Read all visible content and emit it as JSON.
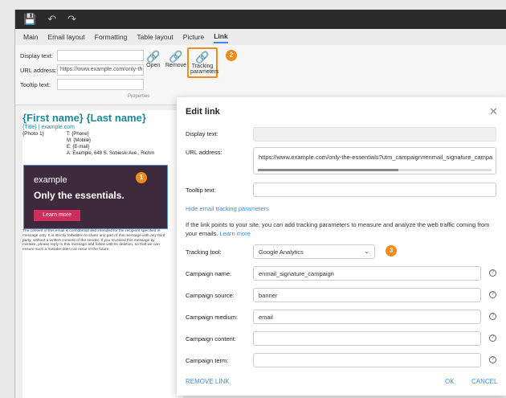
{
  "ribbon": {
    "tabs": [
      "Main",
      "Email layout",
      "Formatting",
      "Table layout",
      "Picture",
      "Link"
    ],
    "display_text_label": "Display text:",
    "url_label": "URL address:",
    "url_value": "https://www.example.com/only-th",
    "tooltip_label": "Tooltip text:",
    "open_label": "Open",
    "remove_label": "Remove",
    "tracking_label_1": "Tracking",
    "tracking_label_2": "parameters",
    "group_label": "Properties"
  },
  "signature": {
    "name": "{First name} {Last name}",
    "title_line": "{Title} | example.com",
    "photo": "{Photo 1}",
    "phone": "T: {Phone}",
    "mobile": "M: {Mobile}",
    "email": "E: {E-mail}",
    "address": "A: Example, 648 S. Sobieski Ave., Richm",
    "banner_logo": "example",
    "banner_tagline": "Only the essentials.",
    "banner_button": "Learn more",
    "disclaimer": "The content of this email is confidential and intended for the recipient specified in message only. It is strictly forbidden to share any part of this message with any third party, without a written consent of the sender. If you received this message by mistake, please reply to this message and follow with its deletion, so that we can ensure such a mistake does not occur in the future."
  },
  "badges": [
    "1",
    "2",
    "3"
  ],
  "dialog": {
    "title": "Edit link",
    "display_text_label": "Display text:",
    "url_label": "URL address:",
    "url_value": "https://www.example.com/only-the-essentials?utm_campaign=enmail_signature_campa",
    "tooltip_label": "Tooltip text:",
    "hide_tracking_link": "Hide email tracking parameters",
    "info_text": "If the link points to your site, you can add tracking parameters to measure and analyze the web traffic coming from your emails.",
    "learn_more": "Learn more",
    "tracking_tool_label": "Tracking tool:",
    "tracking_tool_value": "Google Analytics",
    "campaign_name_label": "Campaign name:",
    "campaign_name_value": "enmail_signature_campaign",
    "campaign_source_label": "Campaign source:",
    "campaign_source_value": "banner",
    "campaign_medium_label": "Campaign medium:",
    "campaign_medium_value": "email",
    "campaign_content_label": "Campaign content:",
    "campaign_term_label": "Campaign term:",
    "remove_link": "REMOVE LINK",
    "ok": "OK",
    "cancel": "CANCEL"
  },
  "colors": {
    "accent": "#3a8dde",
    "badge": "#f28a1c",
    "teal": "#1a8a99"
  }
}
